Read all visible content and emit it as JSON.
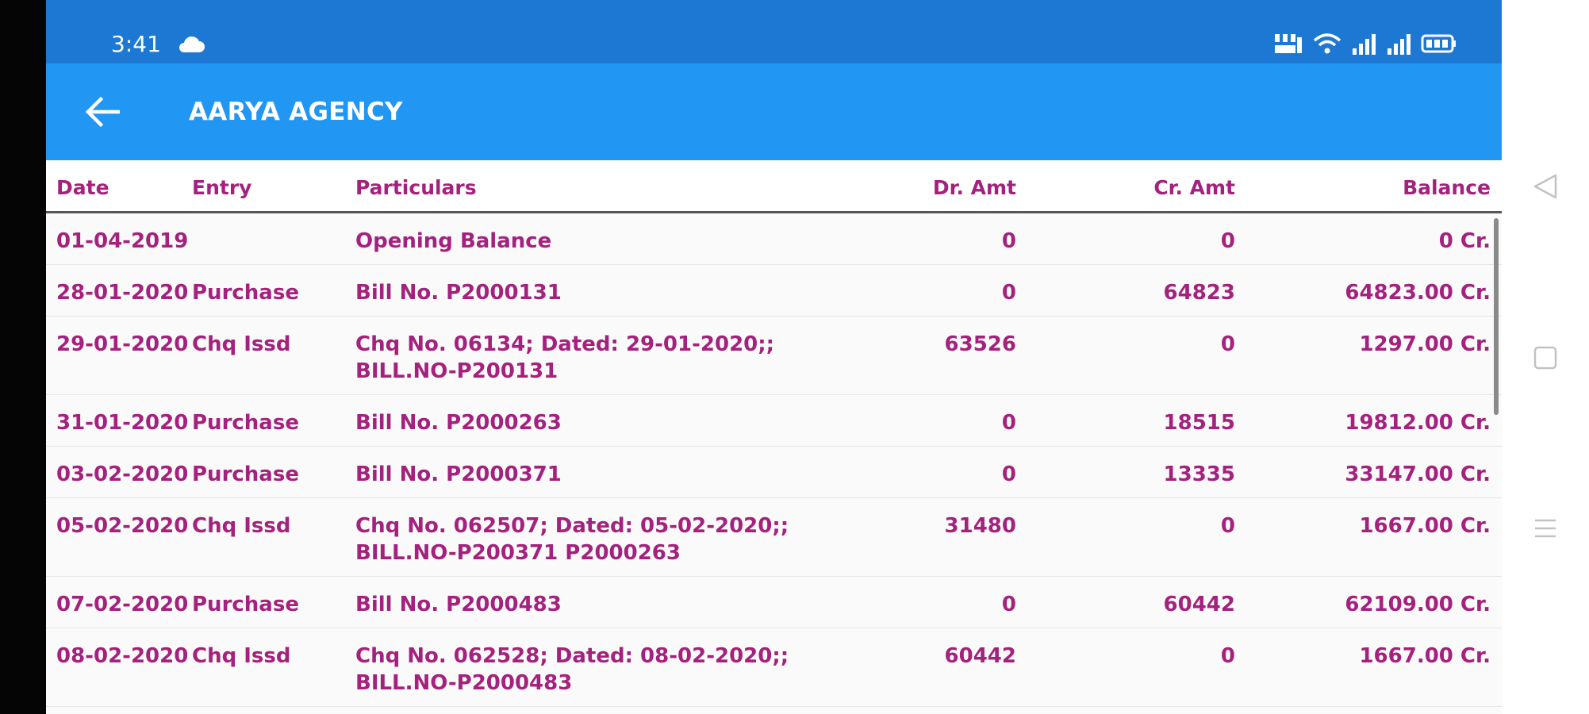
{
  "status_bar": {
    "time": "3:41"
  },
  "app_bar": {
    "title": "AARYA AGENCY"
  },
  "table": {
    "headers": {
      "date": "Date",
      "entry": "Entry",
      "particulars": "Particulars",
      "dr_amt": "Dr. Amt",
      "cr_amt": "Cr. Amt",
      "balance": "Balance"
    },
    "rows": [
      {
        "date": "01-04-2019",
        "entry": "",
        "particulars": "Opening Balance",
        "dr_amt": "0",
        "cr_amt": "0",
        "balance": "0 Cr."
      },
      {
        "date": "28-01-2020",
        "entry": "Purchase",
        "particulars": "Bill No. P2000131",
        "dr_amt": "0",
        "cr_amt": "64823",
        "balance": "64823.00 Cr."
      },
      {
        "date": "29-01-2020",
        "entry": "Chq Issd",
        "particulars": "Chq No. 06134; Dated: 29-01-2020;;\nBILL.NO-P200131",
        "dr_amt": "63526",
        "cr_amt": "0",
        "balance": "1297.00 Cr."
      },
      {
        "date": "31-01-2020",
        "entry": "Purchase",
        "particulars": "Bill No. P2000263",
        "dr_amt": "0",
        "cr_amt": "18515",
        "balance": "19812.00 Cr."
      },
      {
        "date": "03-02-2020",
        "entry": "Purchase",
        "particulars": "Bill No. P2000371",
        "dr_amt": "0",
        "cr_amt": "13335",
        "balance": "33147.00 Cr."
      },
      {
        "date": "05-02-2020",
        "entry": "Chq Issd",
        "particulars": "Chq No. 062507; Dated: 05-02-2020;;\nBILL.NO-P200371 P2000263",
        "dr_amt": "31480",
        "cr_amt": "0",
        "balance": "1667.00 Cr."
      },
      {
        "date": "07-02-2020",
        "entry": "Purchase",
        "particulars": "Bill No. P2000483",
        "dr_amt": "0",
        "cr_amt": "60442",
        "balance": "62109.00 Cr."
      },
      {
        "date": "08-02-2020",
        "entry": "Chq Issd",
        "particulars": "Chq No. 062528; Dated: 08-02-2020;;\nBILL.NO-P2000483",
        "dr_amt": "60442",
        "cr_amt": "0",
        "balance": "1667.00 Cr."
      }
    ]
  },
  "icons": {
    "back": "arrow-left-icon",
    "cloud": "cloud-icon",
    "network": "network-type-icon",
    "wifi": "wifi-icon",
    "signal": "signal-icon",
    "battery": "battery-icon",
    "nav_back": "triangle-back-icon",
    "nav_home": "square-home-icon",
    "nav_menu": "menu-icon"
  },
  "colors": {
    "status_bar": "#1c78d2",
    "app_bar": "#2196f3",
    "text_accent": "#a4217e"
  }
}
